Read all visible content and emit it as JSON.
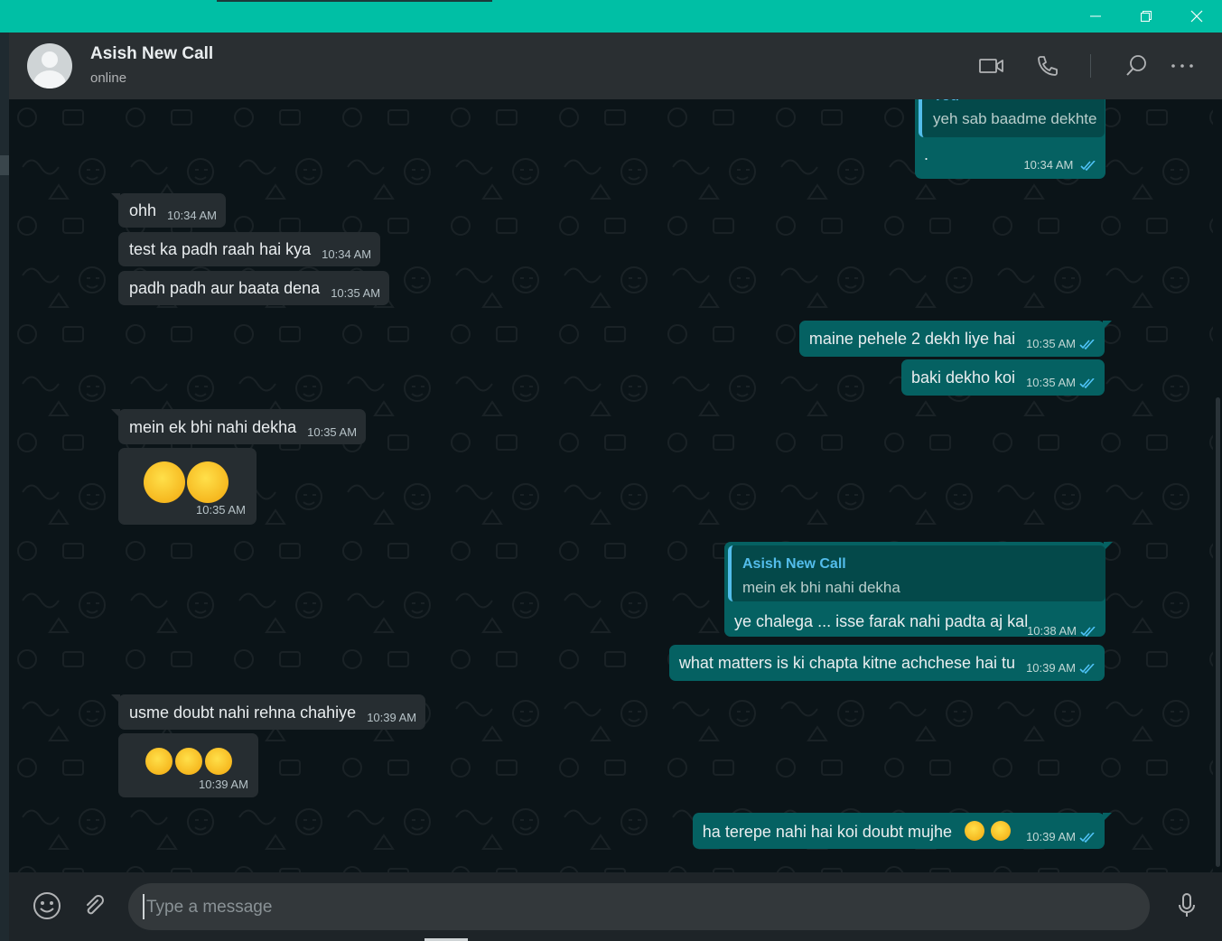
{
  "window": {
    "controls": [
      "minimize-icon",
      "restore-icon",
      "close-icon"
    ],
    "accent": "#00bfa5"
  },
  "header": {
    "contact_name": "Asish New Call",
    "status": "online",
    "icons": [
      "video-call-icon",
      "voice-call-icon",
      "search-icon",
      "menu-icon"
    ]
  },
  "messages": [
    {
      "dir": "out",
      "partial_quote_label": "You",
      "quote_text": "yeh sab baadme dekhte",
      "text": ".",
      "time": "10:34 AM",
      "read": true
    },
    {
      "dir": "in",
      "text": "ohh",
      "time": "10:34 AM"
    },
    {
      "dir": "in",
      "text": "test ka padh raah hai kya",
      "time": "10:34 AM"
    },
    {
      "dir": "in",
      "text": "padh padh aur baata dena",
      "time": "10:35 AM"
    },
    {
      "dir": "out",
      "text": "maine pehele 2 dekh liye hai",
      "time": "10:35 AM",
      "read": true
    },
    {
      "dir": "out",
      "text": "baki dekho koi",
      "time": "10:35 AM",
      "read": true
    },
    {
      "dir": "in",
      "text": "mein ek bhi nahi dekha",
      "time": "10:35 AM"
    },
    {
      "dir": "in",
      "emoji": "😂😂",
      "time": "10:35 AM"
    },
    {
      "dir": "out",
      "quote_name": "Asish New Call",
      "quote_text": "mein ek bhi nahi dekha",
      "text": "ye chalega ... isse farak nahi padta aj kal",
      "time": "10:38 AM",
      "read": true
    },
    {
      "dir": "out",
      "text": "what matters is ki chapta kitne achchese hai tu",
      "time": "10:39 AM",
      "read": true
    },
    {
      "dir": "in",
      "text": "usme doubt nahi rehna chahiye",
      "time": "10:39 AM"
    },
    {
      "dir": "in",
      "emoji": "😂😂😂",
      "time": "10:39 AM"
    },
    {
      "dir": "out",
      "text": "ha terepe nahi hai koi doubt mujhe",
      "emoji_suffix": "😂😂",
      "time": "10:39 AM",
      "read": true
    }
  ],
  "composer": {
    "placeholder": "Type a message",
    "value": "",
    "icons": [
      "emoji-icon",
      "attach-icon",
      "mic-icon"
    ]
  },
  "colors": {
    "incoming_bubble": "#262d31",
    "outgoing_bubble": "#056162",
    "read_ticks": "#4fc3f7",
    "quote_name": "#53bdeb"
  }
}
